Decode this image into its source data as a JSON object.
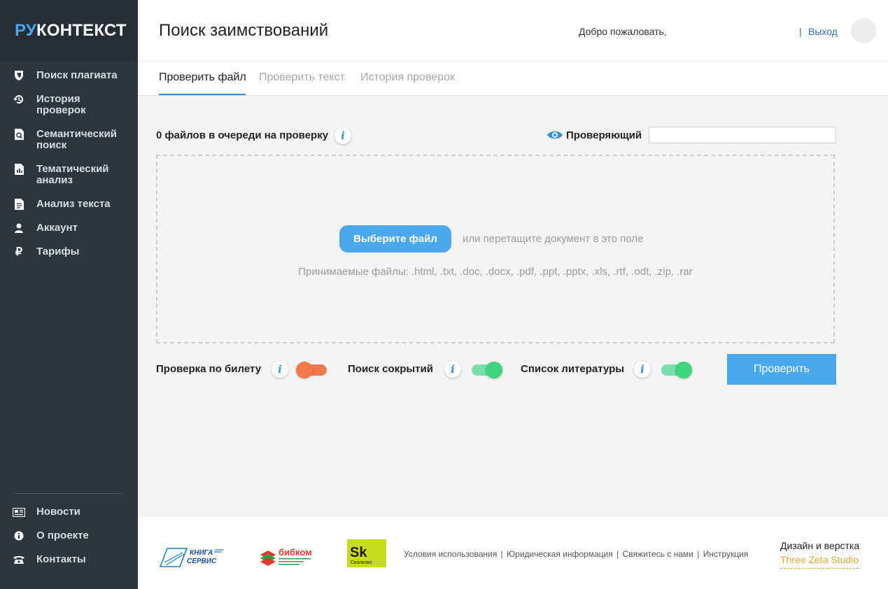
{
  "app": {
    "logo_a": "РУ",
    "logo_b": "КОНТЕКСТ"
  },
  "sidebar": {
    "items": [
      {
        "label": "Поиск плагиата",
        "icon": "shield-icon"
      },
      {
        "label": "История проверок",
        "icon": "history-icon"
      },
      {
        "label": "Семантический\nпоиск",
        "icon": "doc-search-icon"
      },
      {
        "label": "Тематический\nанализ",
        "icon": "doc-chart-icon"
      },
      {
        "label": "Анализ текста",
        "icon": "document-icon"
      },
      {
        "label": "Аккаунт",
        "icon": "user-icon"
      },
      {
        "label": "Тарифы",
        "icon": "ruble-icon"
      }
    ],
    "bottom_items": [
      {
        "label": "Новости",
        "icon": "newspaper-icon"
      },
      {
        "label": "О проекте",
        "icon": "info-icon"
      },
      {
        "label": "Контакты",
        "icon": "phone-icon"
      }
    ]
  },
  "header": {
    "title": "Поиск заимствований",
    "welcome": "Добро пожаловать,",
    "separator": "|",
    "logout": "Выход"
  },
  "tabs": [
    {
      "label": "Проверить файл",
      "active": true
    },
    {
      "label": "Проверить текст",
      "active": false
    },
    {
      "label": "История проверок",
      "active": false
    }
  ],
  "main": {
    "queue_label": "0 файлов в очереди на проверку",
    "info_glyph": "i",
    "reviewer_label": "Проверяющий",
    "reviewer_value": "",
    "choose_file": "Выберите файл",
    "drag_text": "или перетащите документ в это поле",
    "accepted": "Принимаемые файлы: .html, .txt, .doc, .docx, .pdf, .ppt, .pptx, .xls, .rtf, .odt, .zip, .rar",
    "options": [
      {
        "label": "Проверка по билету",
        "on": false
      },
      {
        "label": "Поиск сокрытий",
        "on": true
      },
      {
        "label": "Список литературы",
        "on": true
      }
    ],
    "check_button": "Проверить"
  },
  "footer": {
    "partners": [
      {
        "name": "Книга-Сервис",
        "line1": "КНИГА",
        "line2": "СЕРВИС"
      },
      {
        "name": "бибком",
        "line1": "бибком"
      },
      {
        "name": "Сколково",
        "line1": "Sk",
        "line2": "Сколково"
      }
    ],
    "links": [
      "Условия использования",
      "Юридическая информация",
      "Свяжитесь с нами",
      "Инструкция"
    ],
    "link_separator": "|",
    "credit": "Дизайн и верстка",
    "studio": "Three Zeta Studio"
  },
  "colors": {
    "accent": "#4aa8f0",
    "sidebar_bg": "#2e353f",
    "toggle_off": "#f57a4b",
    "toggle_on": "#3fd47b",
    "studio": "#e3a33b"
  }
}
